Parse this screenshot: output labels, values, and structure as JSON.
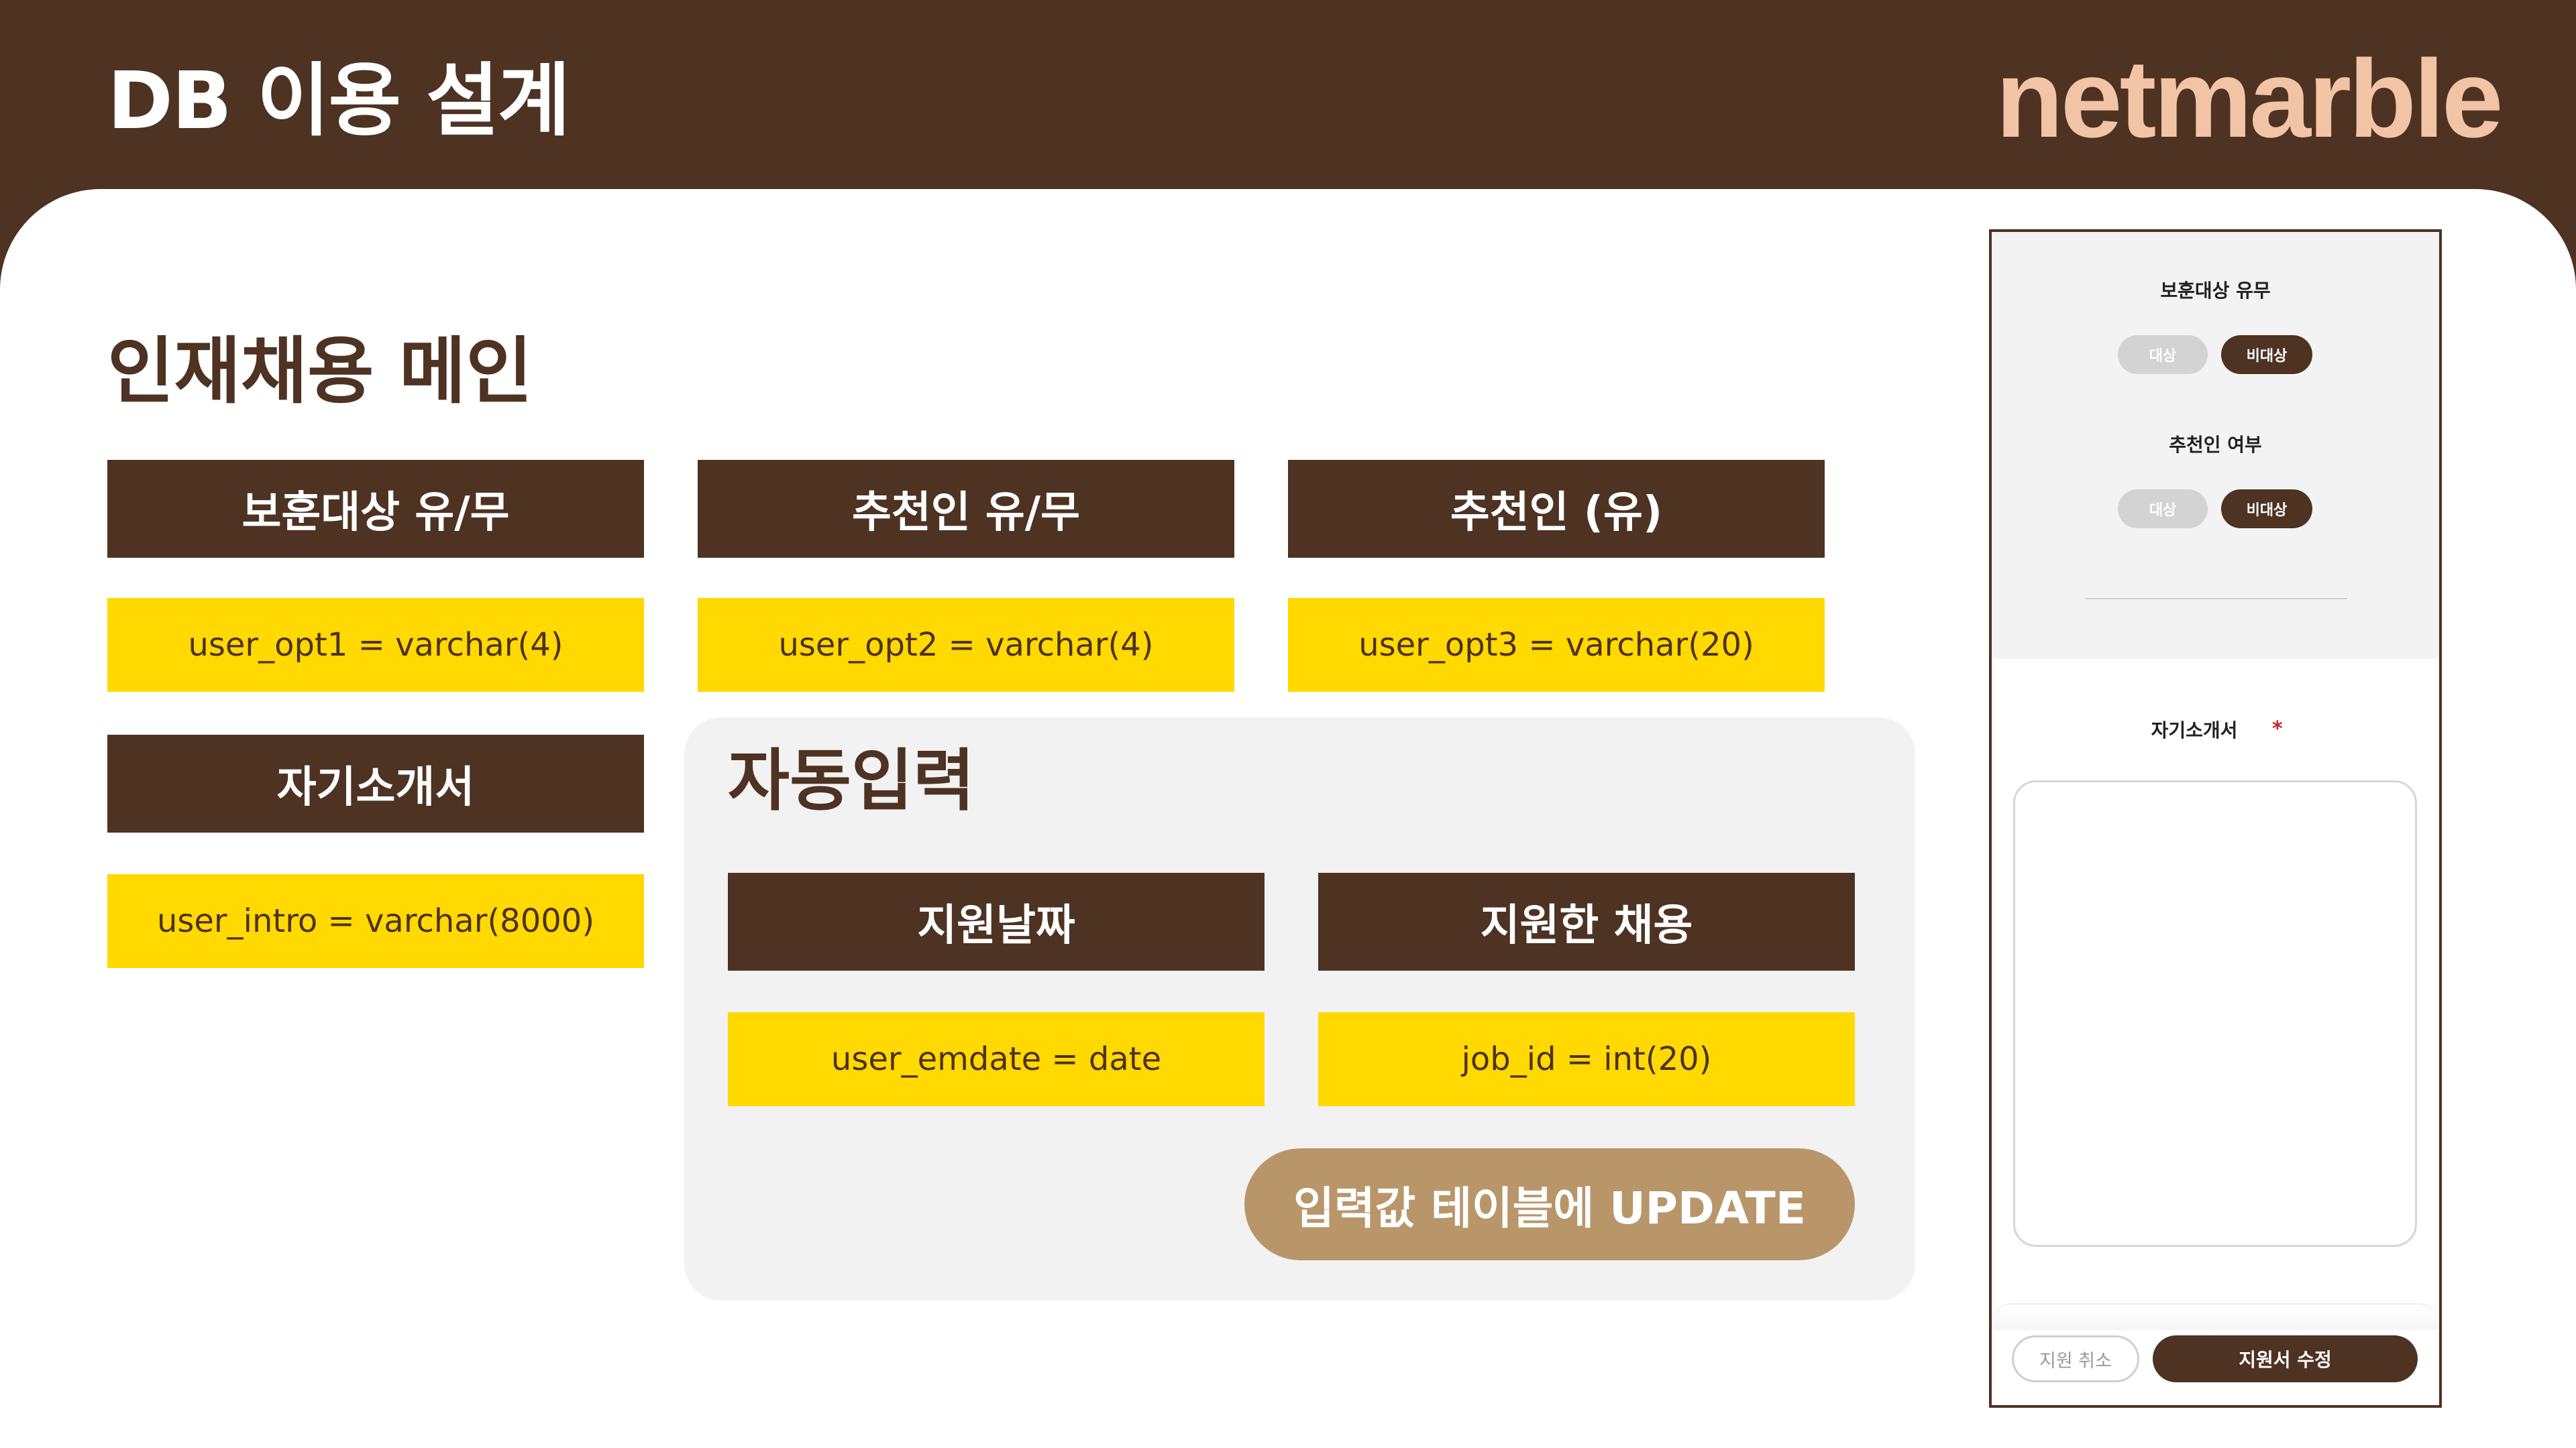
{
  "header": {
    "title": "DB 이용 설계",
    "brand": "netmarble"
  },
  "colors": {
    "brand_dark": "#4e3222",
    "field_yellow": "#ffd900",
    "logo_peach": "#f2c4a6",
    "update_tan": "#b8966a"
  },
  "section": {
    "title": "인재채용 메인"
  },
  "fields": [
    {
      "label": "보훈대상 유/무",
      "column": "user_opt1 = varchar(4)"
    },
    {
      "label": "추천인 유/무",
      "column": "user_opt2 = varchar(4)"
    },
    {
      "label": "추천인 (유)",
      "column": "user_opt3 = varchar(20)"
    },
    {
      "label": "자기소개서",
      "column": "user_intro = varchar(8000)"
    }
  ],
  "auto": {
    "title": "자동입력",
    "fields": [
      {
        "label": "지원날짜",
        "column": "user_emdate = date"
      },
      {
        "label": "지원한 채용",
        "column": "job_id = int(20)"
      }
    ],
    "update_button": "입력값 테이블에 UPDATE"
  },
  "phone": {
    "veteran_label": "보훈대상 유무",
    "veteran_options": [
      "대상",
      "비대상"
    ],
    "referrer_label": "추천인 여부",
    "referrer_options": [
      "대상",
      "비대상"
    ],
    "intro_label": "자기소개서",
    "required_mark": "*",
    "cancel_button": "지원 취소",
    "edit_button": "지원서 수정"
  }
}
